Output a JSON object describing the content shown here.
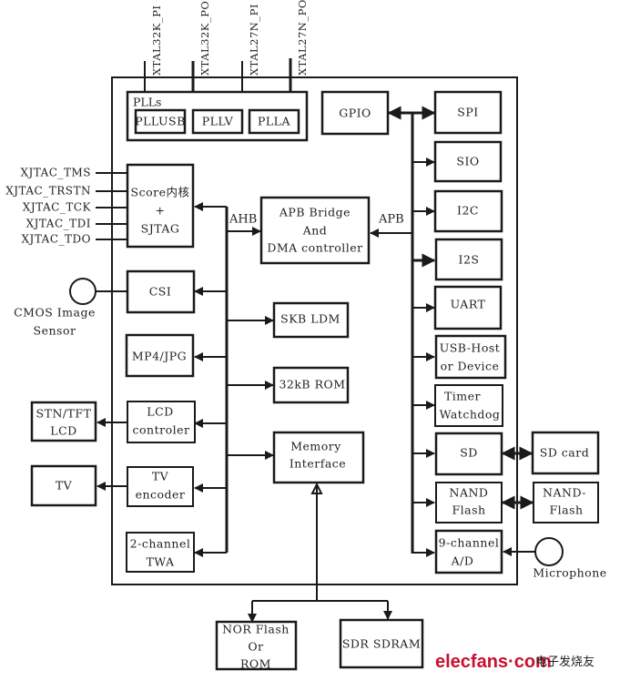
{
  "diagram": {
    "crystal_pins": [
      "XTAL32K_PI",
      "XTAL32K_PO",
      "XTAL27N_PI",
      "XTAL27N_PO"
    ],
    "plls": {
      "title": "PLLs",
      "items": [
        "PLLUSB",
        "PLLV",
        "PLLA"
      ]
    },
    "jtag_pins": [
      "XJTAC_TMS",
      "XJTAC_TRSTN",
      "XJTAC_TCK",
      "XJTAC_TDI",
      "XJTAC_TDO"
    ],
    "core": {
      "line1": "Score内核",
      "line2": "+",
      "line3": "SJTAG"
    },
    "buses": {
      "ahb": "AHB",
      "apb": "APB"
    },
    "apb_bridge": {
      "line1": "APB Bridge",
      "line2": "And",
      "line3": "DMA controller"
    },
    "gpio": "GPIO",
    "apb_peripherals": [
      {
        "line1": "SPI",
        "line2": ""
      },
      {
        "line1": "SIO",
        "line2": ""
      },
      {
        "line1": "I2C",
        "line2": ""
      },
      {
        "line1": "I2S",
        "line2": ""
      },
      {
        "line1": "UART",
        "line2": ""
      },
      {
        "line1": "USB-Host",
        "line2": "or Device"
      },
      {
        "line1": "Timer",
        "line2": "Watchdog"
      },
      {
        "line1": "SD",
        "line2": ""
      },
      {
        "line1": "NAND",
        "line2": "Flash"
      },
      {
        "line1": "9-channel",
        "line2": "A/D"
      }
    ],
    "ahb_blocks": {
      "csi": "CSI",
      "mp4": "MP4/JPG",
      "lcd_ctrl": {
        "line1": "LCD",
        "line2": "controler"
      },
      "tv_enc": {
        "line1": "TV",
        "line2": "encoder"
      },
      "twa": {
        "line1": "2-channel",
        "line2": "TWA"
      },
      "sram": "SKB LDM",
      "rom": "32kB ROM",
      "mem_if": {
        "line1": "Memory",
        "line2": "Interface"
      }
    },
    "external": {
      "cmos": {
        "line1": "CMOS Image",
        "line2": "Sensor"
      },
      "lcd": {
        "line1": "STN/TFT",
        "line2": "LCD"
      },
      "tv": "TV",
      "sd_card": "SD card",
      "nand": {
        "line1": "NAND-",
        "line2": "Flash"
      },
      "microphone": "Microphone",
      "nor": {
        "line1": "NOR Flash",
        "line2": "Or",
        "line3": "ROM"
      },
      "sdram": "SDR SDRAM"
    },
    "watermark": {
      "brand": "elecfans·com",
      "cn": "电子发烧友"
    }
  }
}
